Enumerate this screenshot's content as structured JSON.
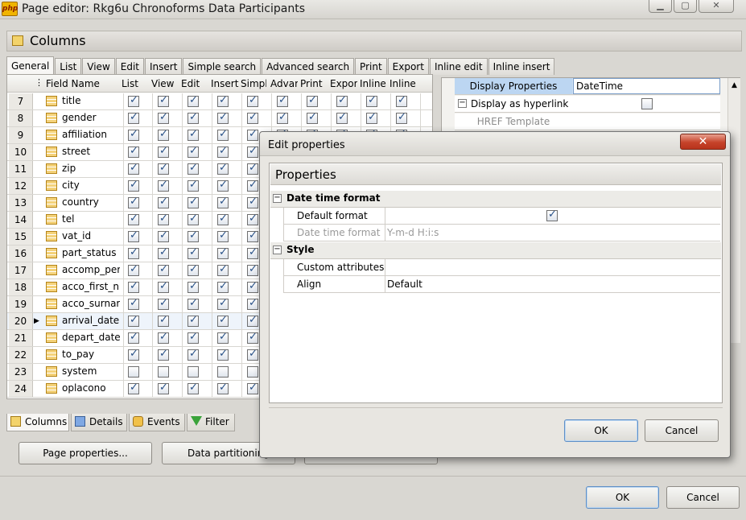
{
  "window": {
    "title": "Page editor: Rkg6u Chronoforms Data Participants",
    "app_icon": "php"
  },
  "section_title": "Columns",
  "tabs": [
    "General",
    "List",
    "View",
    "Edit",
    "Insert",
    "Simple search",
    "Advanced search",
    "Print",
    "Export",
    "Inline edit",
    "Inline insert"
  ],
  "grid": {
    "headers": [
      "Field Name",
      "List",
      "View",
      "Edit",
      "Insert",
      "Simpl",
      "Advar",
      "Print",
      "Expor",
      "Inline",
      "Inline"
    ],
    "rows": [
      {
        "num": "7",
        "name": "title",
        "checks": [
          1,
          1,
          1,
          1,
          1,
          1,
          1,
          1,
          1,
          1
        ]
      },
      {
        "num": "8",
        "name": "gender",
        "checks": [
          1,
          1,
          1,
          1,
          1,
          1,
          1,
          1,
          1,
          1
        ]
      },
      {
        "num": "9",
        "name": "affiliation",
        "checks": [
          1,
          1,
          1,
          1,
          1,
          1,
          1,
          1,
          1,
          1
        ]
      },
      {
        "num": "10",
        "name": "street",
        "checks": [
          1,
          1,
          1,
          1,
          1,
          1,
          1,
          1,
          1,
          1
        ]
      },
      {
        "num": "11",
        "name": "zip",
        "checks": [
          1,
          1,
          1,
          1,
          1,
          1,
          1,
          1,
          1,
          1
        ]
      },
      {
        "num": "12",
        "name": "city",
        "checks": [
          1,
          1,
          1,
          1,
          1,
          1,
          1,
          1,
          1,
          1
        ]
      },
      {
        "num": "13",
        "name": "country",
        "checks": [
          1,
          1,
          1,
          1,
          1,
          1,
          1,
          1,
          1,
          1
        ]
      },
      {
        "num": "14",
        "name": "tel",
        "checks": [
          1,
          1,
          1,
          1,
          1,
          1,
          1,
          1,
          1,
          1
        ]
      },
      {
        "num": "15",
        "name": "vat_id",
        "checks": [
          1,
          1,
          1,
          1,
          1,
          1,
          1,
          1,
          1,
          1
        ]
      },
      {
        "num": "16",
        "name": "part_status",
        "checks": [
          1,
          1,
          1,
          1,
          1,
          1,
          1,
          1,
          1,
          1
        ]
      },
      {
        "num": "17",
        "name": "accomp_per",
        "checks": [
          1,
          1,
          1,
          1,
          1,
          1,
          1,
          1,
          1,
          1
        ]
      },
      {
        "num": "18",
        "name": "acco_first_n",
        "checks": [
          1,
          1,
          1,
          1,
          1,
          1,
          1,
          1,
          1,
          1
        ]
      },
      {
        "num": "19",
        "name": "acco_surnar",
        "checks": [
          1,
          1,
          1,
          1,
          1,
          1,
          1,
          1,
          1,
          1
        ]
      },
      {
        "num": "20",
        "name": "arrival_date",
        "checks": [
          1,
          1,
          1,
          1,
          1,
          1,
          1,
          1,
          1,
          1
        ],
        "selected": true
      },
      {
        "num": "21",
        "name": "depart_date",
        "checks": [
          1,
          1,
          1,
          1,
          1,
          1,
          1,
          1,
          1,
          1
        ]
      },
      {
        "num": "22",
        "name": "to_pay",
        "checks": [
          1,
          1,
          1,
          1,
          1,
          1,
          1,
          1,
          1,
          1
        ]
      },
      {
        "num": "23",
        "name": "system",
        "checks": [
          0,
          0,
          0,
          0,
          0,
          0,
          0,
          0,
          0,
          0
        ]
      },
      {
        "num": "24",
        "name": "oplacono",
        "checks": [
          1,
          1,
          1,
          1,
          1,
          1,
          1,
          1,
          1,
          1
        ]
      }
    ]
  },
  "right_panel": {
    "display_properties_label": "Display Properties",
    "display_properties_value": "DateTime",
    "hyperlink_label": "Display as hyperlink",
    "href_label": "HREF Template"
  },
  "bottom_tabs": [
    "Columns",
    "Details",
    "Events",
    "Filter"
  ],
  "buttons": {
    "page_properties": "Page properties...",
    "data_partitioning": "Data partitioning",
    "ok": "OK",
    "cancel": "Cancel"
  },
  "dialog": {
    "title": "Edit properties",
    "header": "Properties",
    "section_datetime": "Date time format",
    "default_format_label": "Default format",
    "datetime_format_label": "Date time format",
    "datetime_format_value": "Y-m-d H:i:s",
    "section_style": "Style",
    "custom_attributes_label": "Custom attributes",
    "align_label": "Align",
    "align_value": "Default",
    "ok": "OK",
    "cancel": "Cancel"
  }
}
